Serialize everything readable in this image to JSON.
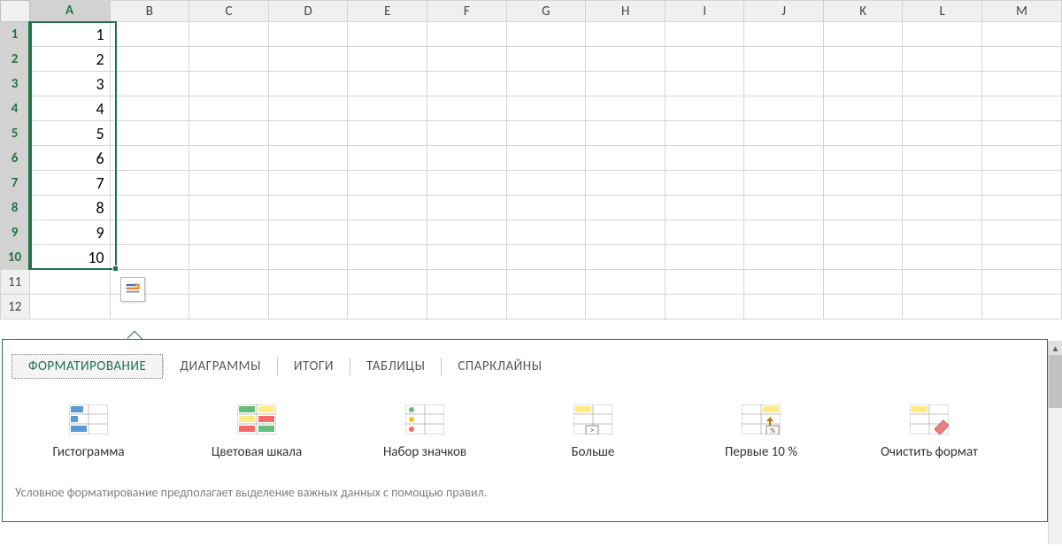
{
  "columns": [
    "A",
    "B",
    "C",
    "D",
    "E",
    "F",
    "G",
    "H",
    "I",
    "J",
    "K",
    "L",
    "M"
  ],
  "rows": [
    "1",
    "2",
    "3",
    "4",
    "5",
    "6",
    "7",
    "8",
    "9",
    "10",
    "11",
    "12"
  ],
  "selected_rows": 10,
  "data": {
    "A": [
      "1",
      "2",
      "3",
      "4",
      "5",
      "6",
      "7",
      "8",
      "9",
      "10"
    ]
  },
  "panel": {
    "tabs": [
      "ФОРМАТИРОВАНИЕ",
      "ДИАГРАММЫ",
      "ИТОГИ",
      "ТАБЛИЦЫ",
      "СПАРКЛАЙНЫ"
    ],
    "active_tab": 0,
    "options": [
      {
        "label": "Гистограмма",
        "icon": "databar"
      },
      {
        "label": "Цветовая шкала",
        "icon": "colorscale"
      },
      {
        "label": "Набор значков",
        "icon": "iconset"
      },
      {
        "label": "Больше",
        "icon": "greater"
      },
      {
        "label": "Первые 10 %",
        "icon": "top10"
      },
      {
        "label": "Очистить формат",
        "icon": "clear"
      }
    ],
    "hint": "Условное форматирование предполагает выделение важных данных с помощью правил."
  }
}
